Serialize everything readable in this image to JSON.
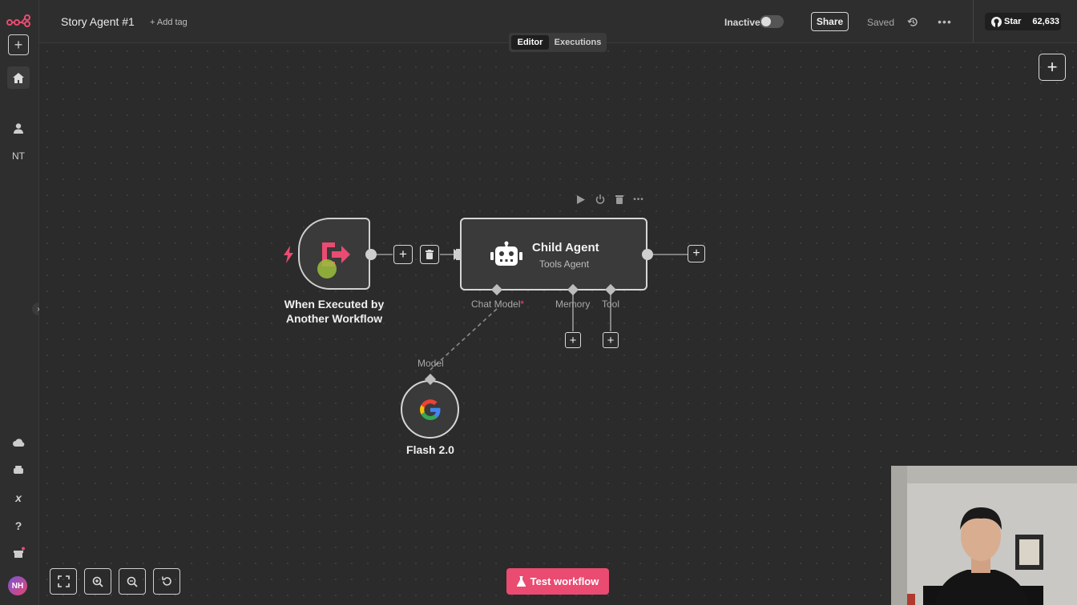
{
  "app": {
    "logo": "n8n-logo-icon"
  },
  "header": {
    "workflow_title": "Story Agent #1",
    "add_tag": "+ Add tag",
    "status_label": "Inactive",
    "share_label": "Share",
    "saved_label": "Saved",
    "star_label": "Star",
    "star_count": "62,633"
  },
  "tabs": [
    {
      "label": "Editor",
      "active": true
    },
    {
      "label": "Executions",
      "active": false
    }
  ],
  "sidebar": {
    "user_initials": "NT",
    "avatar_initials": "NH"
  },
  "nodes": {
    "trigger": {
      "label_line1": "When Executed by",
      "label_line2": "Another Workflow"
    },
    "agent": {
      "title": "Child Agent",
      "subtitle": "Tools Agent",
      "inputs": {
        "chat_model": "Chat Model",
        "required_mark": "*",
        "memory": "Memory",
        "tool": "Tool"
      }
    },
    "model": {
      "input_label": "Model",
      "title": "Flash 2.0"
    }
  },
  "footer": {
    "test_button": "Test workflow"
  },
  "colors": {
    "accent": "#ea4b71",
    "background": "#2b2b2b",
    "node_fill": "#3a3a3a",
    "node_border": "#d6d6d6"
  }
}
